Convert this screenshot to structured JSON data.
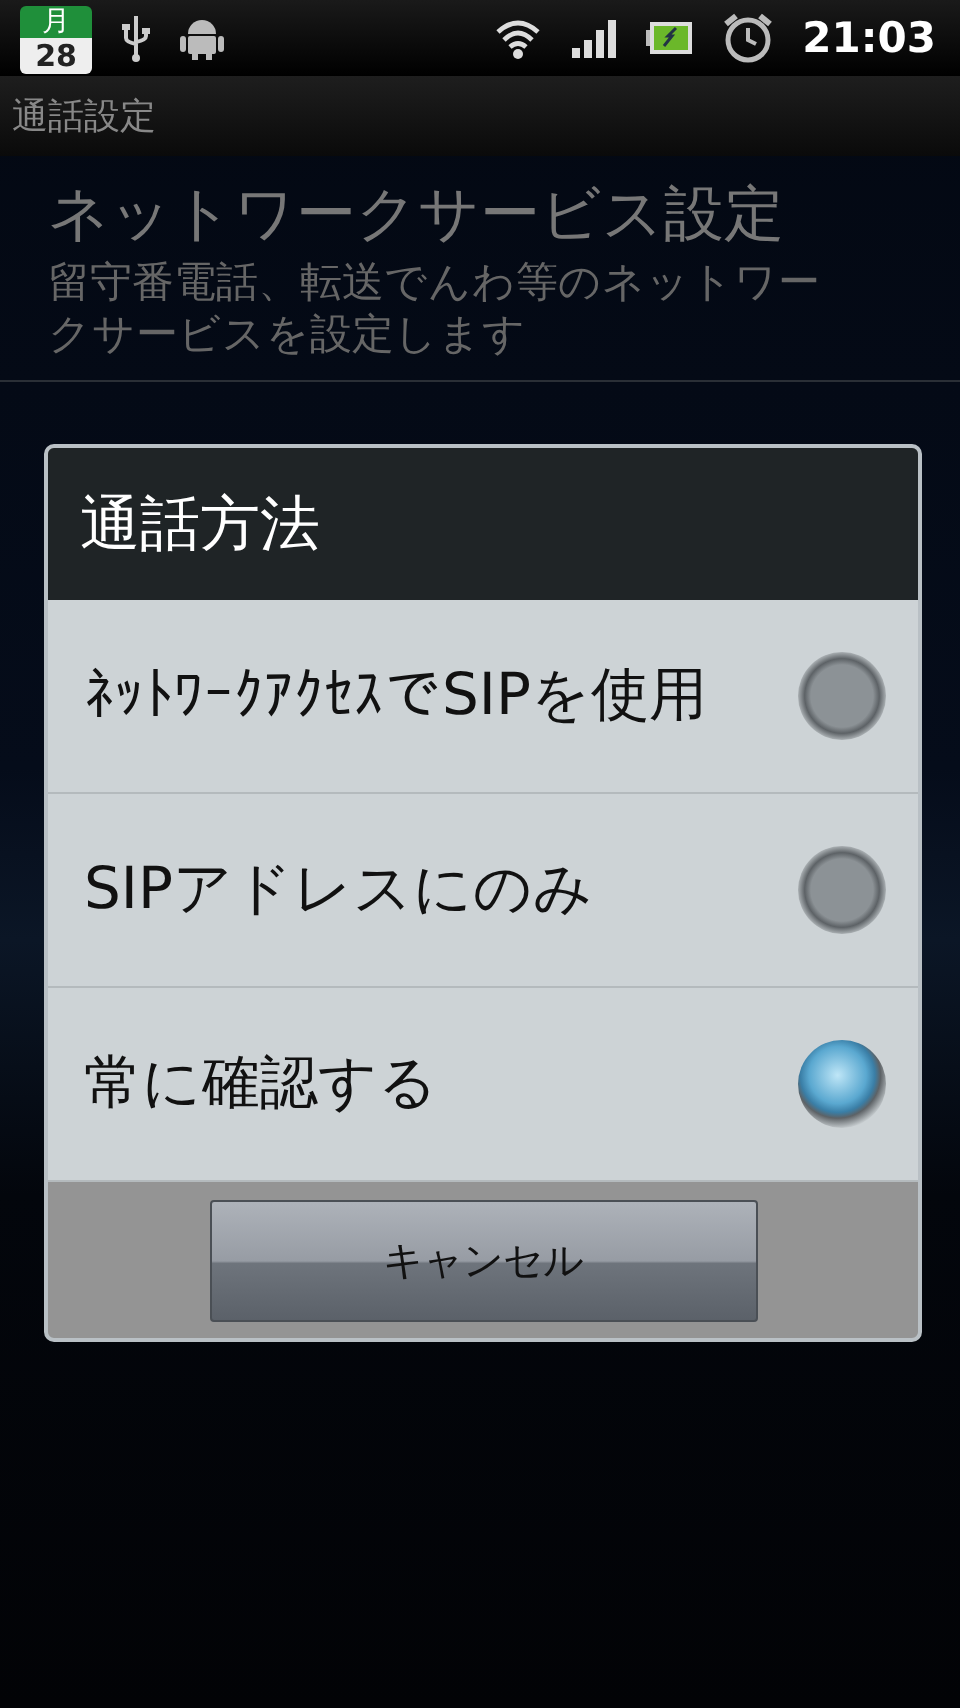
{
  "status_bar": {
    "calendar_month": "月",
    "calendar_day": "28",
    "time": "21:03"
  },
  "title_bar": {
    "title": "通話設定"
  },
  "settings": [
    {
      "title": "ネットワークサービス設定",
      "summary": "留守番電話、転送でんわ等のネットワークサービスを設定します"
    }
  ],
  "dialog": {
    "title": "通話方法",
    "options": [
      {
        "label": "ﾈｯﾄﾜｰｸｱｸｾｽでSIPを使用",
        "selected": false
      },
      {
        "label": "SIPアドレスにのみ",
        "selected": false
      },
      {
        "label": "常に確認する",
        "selected": true
      }
    ],
    "buttons": [
      "キャンセル"
    ]
  }
}
